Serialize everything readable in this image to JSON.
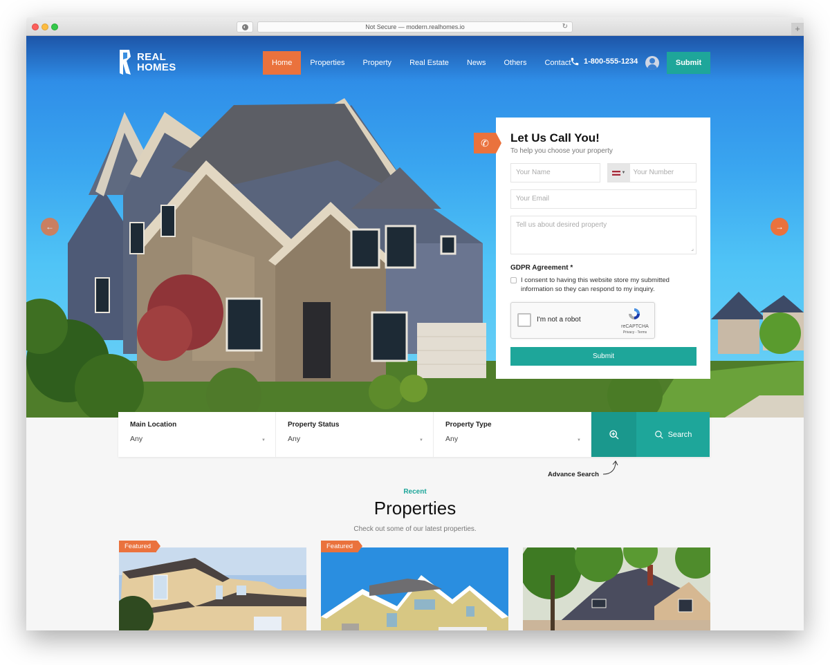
{
  "browser": {
    "url_text": "Not Secure — modern.realhomes.io",
    "reload_icon": "reload-icon",
    "new_tab_icon": "plus-icon"
  },
  "header": {
    "logo_line1": "REAL",
    "logo_line2": "HOMES",
    "nav": [
      {
        "label": "Home",
        "active": true
      },
      {
        "label": "Properties"
      },
      {
        "label": "Property"
      },
      {
        "label": "Real Estate"
      },
      {
        "label": "News"
      },
      {
        "label": "Others"
      },
      {
        "label": "Contact"
      }
    ],
    "phone": "1-800-555-1234",
    "submit_label": "Submit"
  },
  "slider": {
    "prev_icon": "arrow-left-icon",
    "next_icon": "arrow-right-icon"
  },
  "call_form": {
    "title": "Let Us Call You!",
    "subtitle": "To help you choose your property",
    "name_placeholder": "Your Name",
    "number_placeholder": "Your Number",
    "email_placeholder": "Your Email",
    "message_placeholder": "Tell us about desired property",
    "gdpr_title": "GDPR Agreement *",
    "gdpr_text": "I consent to having this website store my submitted information so they can respond to my inquiry.",
    "captcha_label": "I'm not a robot",
    "captcha_brand": "reCAPTCHA",
    "captcha_links": "Privacy - Terms",
    "submit_label": "Submit"
  },
  "search": {
    "fields": [
      {
        "label": "Main Location",
        "value": "Any"
      },
      {
        "label": "Property Status",
        "value": "Any"
      },
      {
        "label": "Property Type",
        "value": "Any"
      }
    ],
    "search_label": "Search",
    "advance_label": "Advance Search"
  },
  "recent": {
    "kicker": "Recent",
    "title": "Properties",
    "subtitle": "Check out some of our latest properties."
  },
  "cards": [
    {
      "badge": "Featured"
    },
    {
      "badge": "Featured"
    },
    {
      "badge": ""
    }
  ],
  "colors": {
    "accent_orange": "#ea723d",
    "accent_teal": "#1ea69a"
  }
}
